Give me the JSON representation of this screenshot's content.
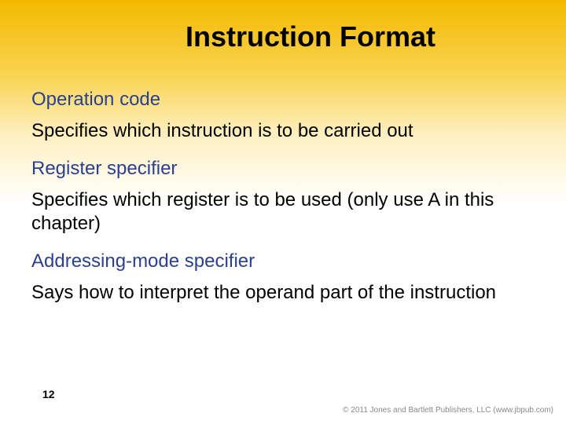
{
  "title": "Instruction Format",
  "items": [
    {
      "term": "Operation code",
      "def": "Specifies which instruction is to be carried out"
    },
    {
      "term": "Register specifier",
      "def": "Specifies which register is to be used (only use A in this chapter)"
    },
    {
      "term": "Addressing-mode specifier",
      "def": "Says how to interpret the operand part of the instruction"
    }
  ],
  "page_number": "12",
  "footer": "© 2011 Jones and Bartlett Publishers, LLC (www.jbpub.com)"
}
